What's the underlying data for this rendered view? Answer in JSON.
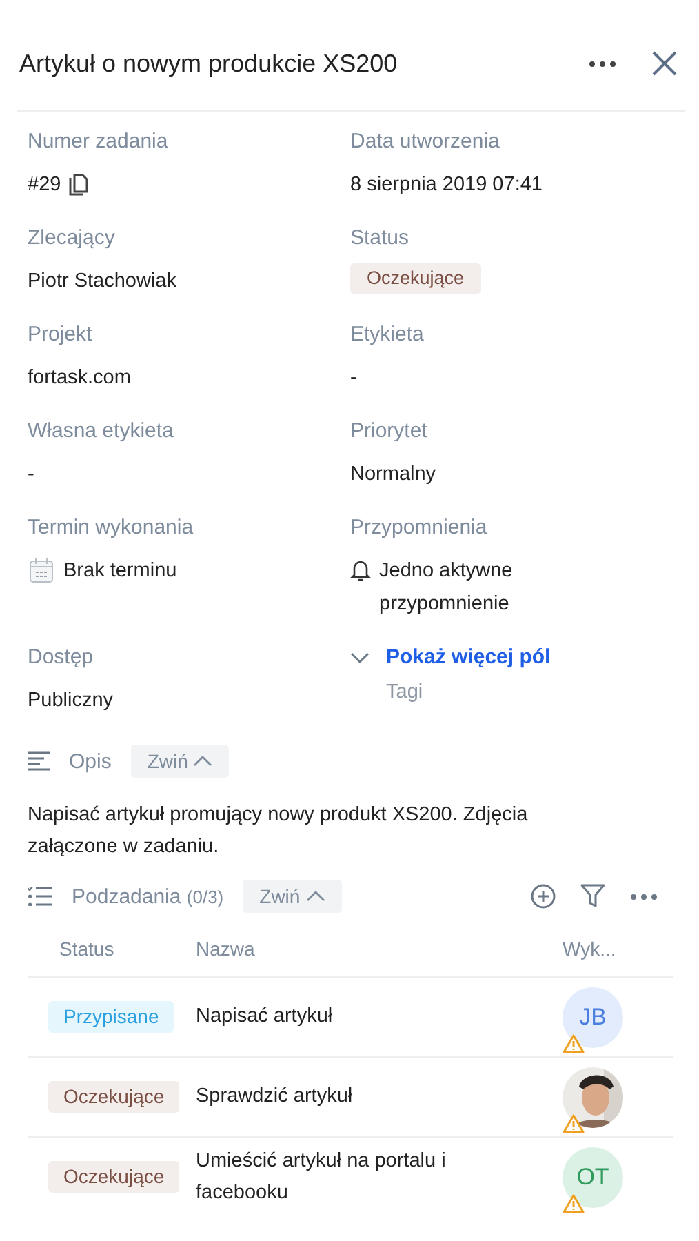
{
  "header": {
    "title": "Artykuł o nowym produkcie XS200"
  },
  "fields": [
    {
      "kind": "id",
      "label": "Numer zadania",
      "value": "#29"
    },
    {
      "kind": "text",
      "label": "Data utworzenia",
      "value": "8 sierpnia 2019 07:41"
    },
    {
      "kind": "text",
      "label": "Zlecający",
      "value": "Piotr Stachowiak"
    },
    {
      "kind": "badge",
      "label": "Status",
      "value": "Oczekujące"
    },
    {
      "kind": "text",
      "label": "Projekt",
      "value": "fortask.com"
    },
    {
      "kind": "text",
      "label": "Etykieta",
      "value": "-"
    },
    {
      "kind": "text",
      "label": "Własna etykieta",
      "value": "-"
    },
    {
      "kind": "text",
      "label": "Priorytet",
      "value": "Normalny"
    },
    {
      "kind": "date",
      "label": "Termin wykonania",
      "value": "Brak terminu"
    },
    {
      "kind": "reminder",
      "label": "Przypomnienia",
      "value": "Jedno aktywne przypomnienie"
    },
    {
      "kind": "text",
      "label": "Dostęp",
      "value": "Publiczny"
    },
    {
      "kind": "more",
      "label": "Pokaż więcej pól",
      "value": "Tagi"
    }
  ],
  "description": {
    "title": "Opis",
    "toggle": "Zwiń",
    "text": "Napisać artykuł promujący nowy produkt XS200. Zdjęcia załączone w zadaniu."
  },
  "subtasks": {
    "title": "Podzadania",
    "count": "(0/3)",
    "toggle": "Zwiń",
    "columns": [
      "Status",
      "Nazwa",
      "Wyk..."
    ],
    "rows": [
      {
        "status": "Przypisane",
        "kind": "assigned",
        "name": "Napisać artykuł",
        "avatar": {
          "kind": "initials",
          "initials": "JB",
          "color": "#e3ecfd"
        },
        "warning": true
      },
      {
        "status": "Oczekujące",
        "kind": "pending",
        "name": "Sprawdzić artykuł",
        "warning": true
      },
      {
        "status": "Oczekujące",
        "kind": "pending",
        "name": "Umieścić artykuł na portalu i facebooku",
        "avatar": {
          "kind": "initials",
          "initials": "OT",
          "color": "#dcf1e5"
        },
        "warning": true
      }
    ]
  }
}
